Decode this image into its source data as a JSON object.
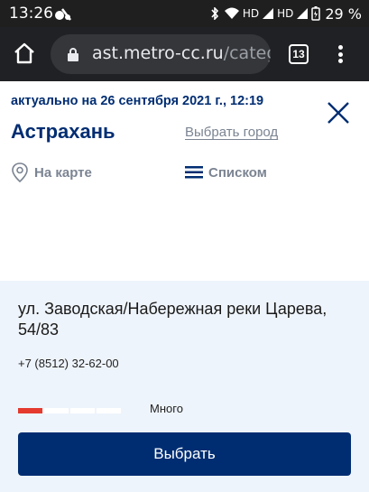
{
  "status_bar": {
    "time": "13:26",
    "network_1": "HD",
    "network_2": "HD",
    "battery": "29 %"
  },
  "browser": {
    "url_host": "ast.metro-cc.ru",
    "url_path": "/catego",
    "tab_count": "13"
  },
  "header": {
    "updated": "актуально на 26 сентября 2021 г., 12:19",
    "city": "Астрахань",
    "choose_city": "Выбрать город"
  },
  "view_toggle": {
    "map_label": "На карте",
    "list_label": "Списком"
  },
  "store": {
    "address": "ул. Заводская/Набережная реки Царева, 54/83",
    "phone": "+7 (8512) 32-62-00",
    "stock_label": "Много",
    "stock_level_segments": 1,
    "stock_total_segments": 4,
    "select_label": "Выбрать"
  },
  "colors": {
    "brand_blue": "#002d72",
    "stock_red": "#e53a2e",
    "panel_bg": "#eef4fb"
  }
}
